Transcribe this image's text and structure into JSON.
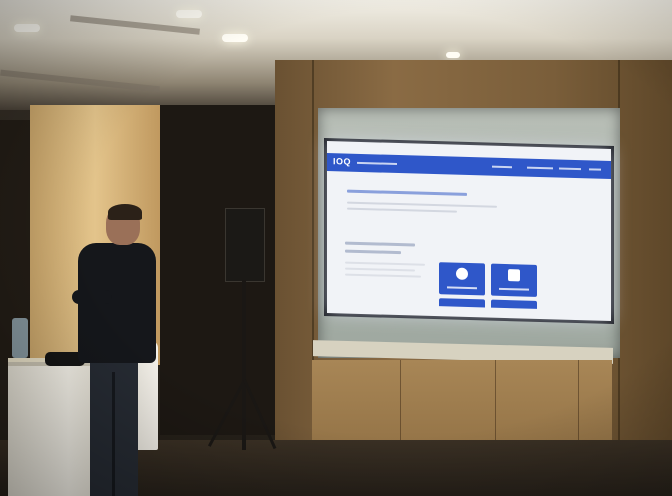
{
  "photo": {
    "subject": "presenter",
    "screen": {
      "brand_logo": "IOQ",
      "accent_color": "#2f57c9",
      "background_color": "#f1f3f7"
    }
  }
}
